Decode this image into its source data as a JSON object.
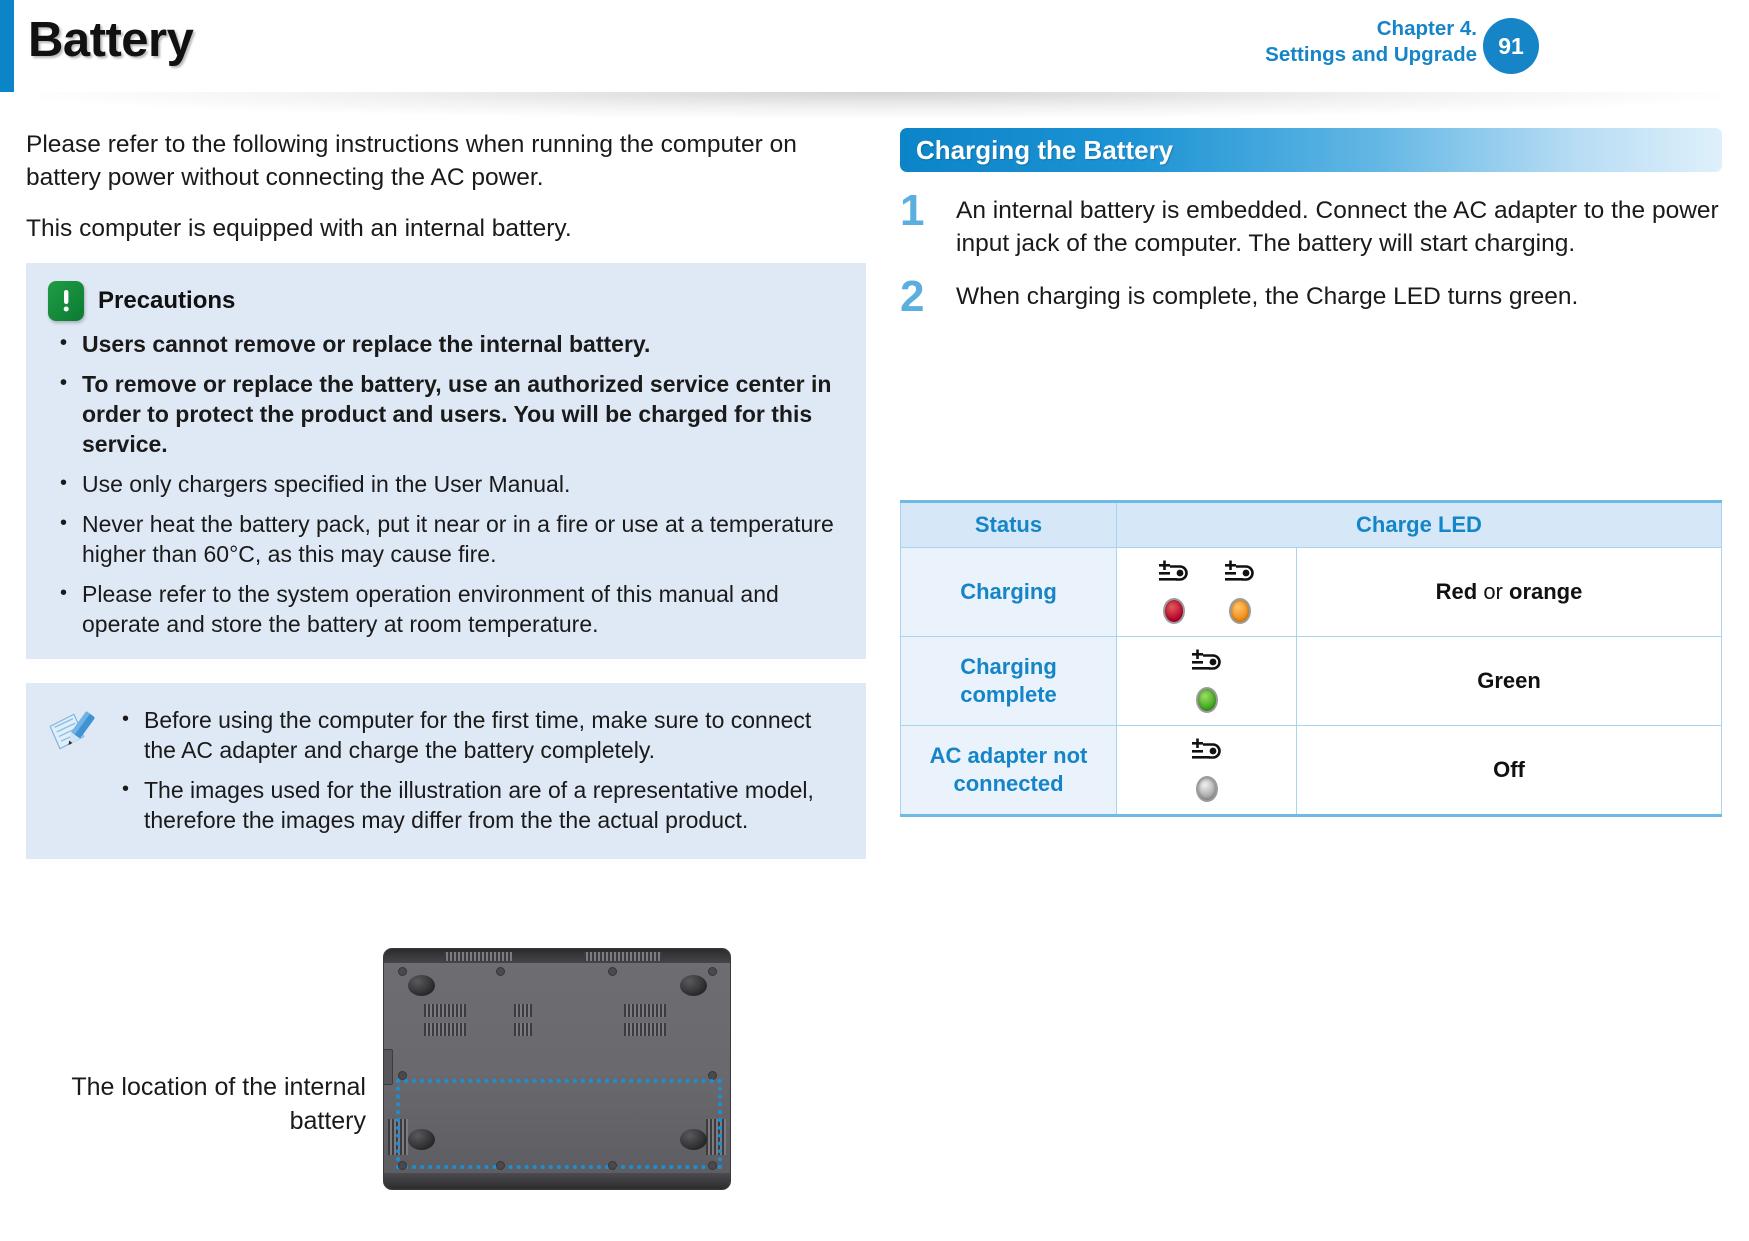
{
  "header": {
    "title": "Battery",
    "chapter_line1": "Chapter 4.",
    "chapter_line2": "Settings and Upgrade",
    "page_number": "91"
  },
  "left": {
    "intro_para_1": "Please refer to the following instructions when running the computer on battery power without connecting the AC power.",
    "intro_para_2": "This computer is equipped with an internal battery.",
    "precautions": {
      "icon": "warning-exclamation-icon",
      "title": "Precautions",
      "items": [
        "Users cannot remove or replace the internal battery.",
        "To remove or replace the battery, use an authorized service center in order to protect the product and users. You will be charged for this service.",
        "Use only chargers specified in the User Manual.",
        "Never heat the battery pack, put it near or in a fire or use at a temperature higher than 60°C, as this may cause fire.",
        "Please refer to the system operation environment of this manual and operate and store the battery at room temperature."
      ]
    },
    "note": {
      "icon": "note-pencil-icon",
      "items": [
        "Before using the computer for the first time, make sure to connect the AC adapter and charge the battery completely.",
        "The images used for the illustration are of a representative model, therefore the images may differ from the the actual product."
      ]
    },
    "figure": {
      "caption": "The location of the internal battery",
      "alt": "laptop-bottom-illustration"
    }
  },
  "right": {
    "section_title": "Charging the Battery",
    "steps": [
      {
        "num": "1",
        "text": "An internal battery is embedded. Connect the AC adapter to the power input jack of the computer. The battery will start charging."
      },
      {
        "num": "2",
        "text": "When charging is complete, the Charge LED turns green."
      }
    ],
    "table": {
      "headers": [
        "Status",
        "Charge LED"
      ],
      "rows": [
        {
          "status": "Charging",
          "leds": [
            {
              "icon": "battery-charge-icon",
              "color": "#b4002a",
              "name": "led-red"
            },
            {
              "icon": "battery-charge-icon",
              "color": "#f08a11",
              "name": "led-orange"
            }
          ],
          "label_strong_1": "Red",
          "label_weak": " or ",
          "label_strong_2": "orange"
        },
        {
          "status": "Charging complete",
          "leds": [
            {
              "icon": "battery-charge-icon",
              "color": "#3ba31c",
              "name": "led-green"
            }
          ],
          "label_strong_1": "Green",
          "label_weak": "",
          "label_strong_2": ""
        },
        {
          "status": "AC adapter not connected",
          "leds": [
            {
              "icon": "battery-charge-icon",
              "color": "#9a9a9a",
              "name": "led-off"
            }
          ],
          "label_strong_1": "Off",
          "label_weak": "",
          "label_strong_2": ""
        }
      ]
    }
  },
  "colors": {
    "accent_blue": "#0c84c8",
    "heading_blue": "#1585c8",
    "step_blue": "#5aafe0",
    "callout_bg": "#dfe9f5",
    "table_header_bg": "#d6e8f7",
    "table_status_bg": "#eaf3fb",
    "warn_green": "#0b7a32",
    "dotted_blue": "#1c8fd6"
  }
}
